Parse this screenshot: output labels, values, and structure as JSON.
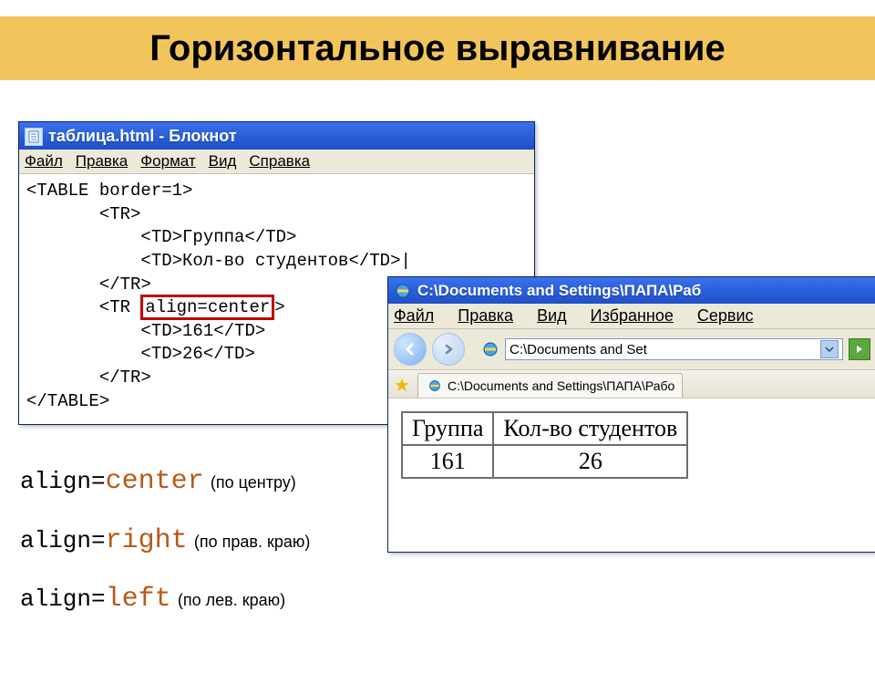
{
  "slide": {
    "title": "Горизонтальное выравнивание"
  },
  "notepad": {
    "title": "таблица.html - Блокнот",
    "menu": {
      "file": "Файл",
      "edit": "Правка",
      "format": "Формат",
      "view": "Вид",
      "help": "Справка"
    },
    "code": {
      "l1": "<TABLE border=1>",
      "l2": "       <TR>",
      "l3": "           <TD>Группа</TD>",
      "l4": "           <TD>Кол-во студентов</TD>|",
      "l5": "       </TR>",
      "l6a": "       <TR ",
      "l6b": "align=center",
      "l6c": ">",
      "l7": "           <TD>161</TD>",
      "l8": "           <TD>26</TD>",
      "l9": "       </TR>",
      "l10": "</TABLE>"
    }
  },
  "ie": {
    "title": "C:\\Documents and Settings\\ПАПА\\Раб",
    "menu": {
      "file": "Файл",
      "edit": "Правка",
      "view": "Вид",
      "fav": "Избранное",
      "tools": "Сервис"
    },
    "addr": "C:\\Documents and Set",
    "tab": "C:\\Documents and Settings\\ПАПА\\Рабо",
    "table": {
      "h1": "Группа",
      "h2": "Кол-во студентов",
      "c1": "161",
      "c2": "26"
    }
  },
  "explain": {
    "kw": "align=",
    "center_val": "center",
    "center_note": "(по центру)",
    "right_val": "right",
    "right_note": "(по прав. краю)",
    "left_val": "left",
    "left_note": "(по лев. краю)"
  }
}
